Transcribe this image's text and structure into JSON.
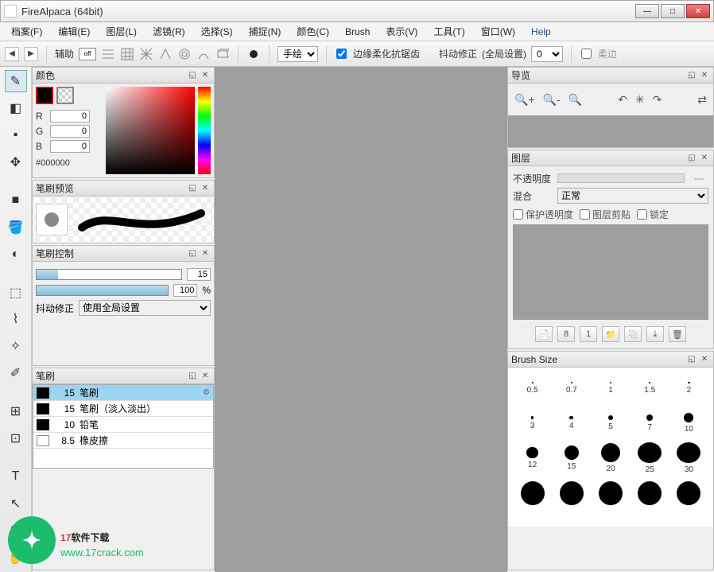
{
  "window": {
    "title": "FireAlpaca (64bit)"
  },
  "menu": [
    "档案(F)",
    "编辑(E)",
    "图层(L)",
    "滤镜(R)",
    "选择(S)",
    "捕捉(N)",
    "颜色(C)",
    "Brush",
    "表示(V)",
    "工具(T)",
    "窗口(W)",
    "Help"
  ],
  "toolbar": {
    "assist": "辅助",
    "off": "off",
    "mode": "手绘",
    "aa_label": "边缘柔化抗锯齿",
    "stab_label": "抖动修正",
    "stab_scope": "(全局设置)",
    "stab_value": "0",
    "soft_label": "柔边"
  },
  "panels": {
    "color": {
      "title": "颜色",
      "r_label": "R",
      "g_label": "G",
      "b_label": "B",
      "r": "0",
      "g": "0",
      "b": "0",
      "hex": "#000000"
    },
    "brush_preview": {
      "title": "笔刷预览"
    },
    "brush_control": {
      "title": "笔刷控制",
      "size_val": "15",
      "opacity_val": "100",
      "opacity_unit": "%",
      "stab_label": "抖动修正",
      "stab_sel": "使用全局设置"
    },
    "brush_list": {
      "title": "笔刷",
      "items": [
        {
          "size": "15",
          "name": "笔刷",
          "sel": true,
          "sw": "black"
        },
        {
          "size": "15",
          "name": "笔刷（淡入淡出）",
          "sel": false,
          "sw": "black"
        },
        {
          "size": "10",
          "name": "铅笔",
          "sel": false,
          "sw": "black"
        },
        {
          "size": "8.5",
          "name": "橡皮擦",
          "sel": false,
          "sw": "white"
        }
      ]
    },
    "nav": {
      "title": "导览"
    },
    "layer": {
      "title": "图层",
      "opacity_label": "不透明度",
      "opacity_val": "---",
      "blend_label": "混合",
      "blend_sel": "正常",
      "chk_protect": "保护透明度",
      "chk_clip": "图层剪贴",
      "chk_lock": "锁定"
    },
    "brush_size": {
      "title": "Brush Size",
      "sizes": [
        0.5,
        0.7,
        1,
        1.5,
        2,
        3,
        4,
        5,
        7,
        10,
        12,
        15,
        20,
        25,
        30
      ]
    }
  },
  "watermark": {
    "line1a": "17",
    "line1b": "软件下载",
    "line2": "www.17crack.com"
  }
}
